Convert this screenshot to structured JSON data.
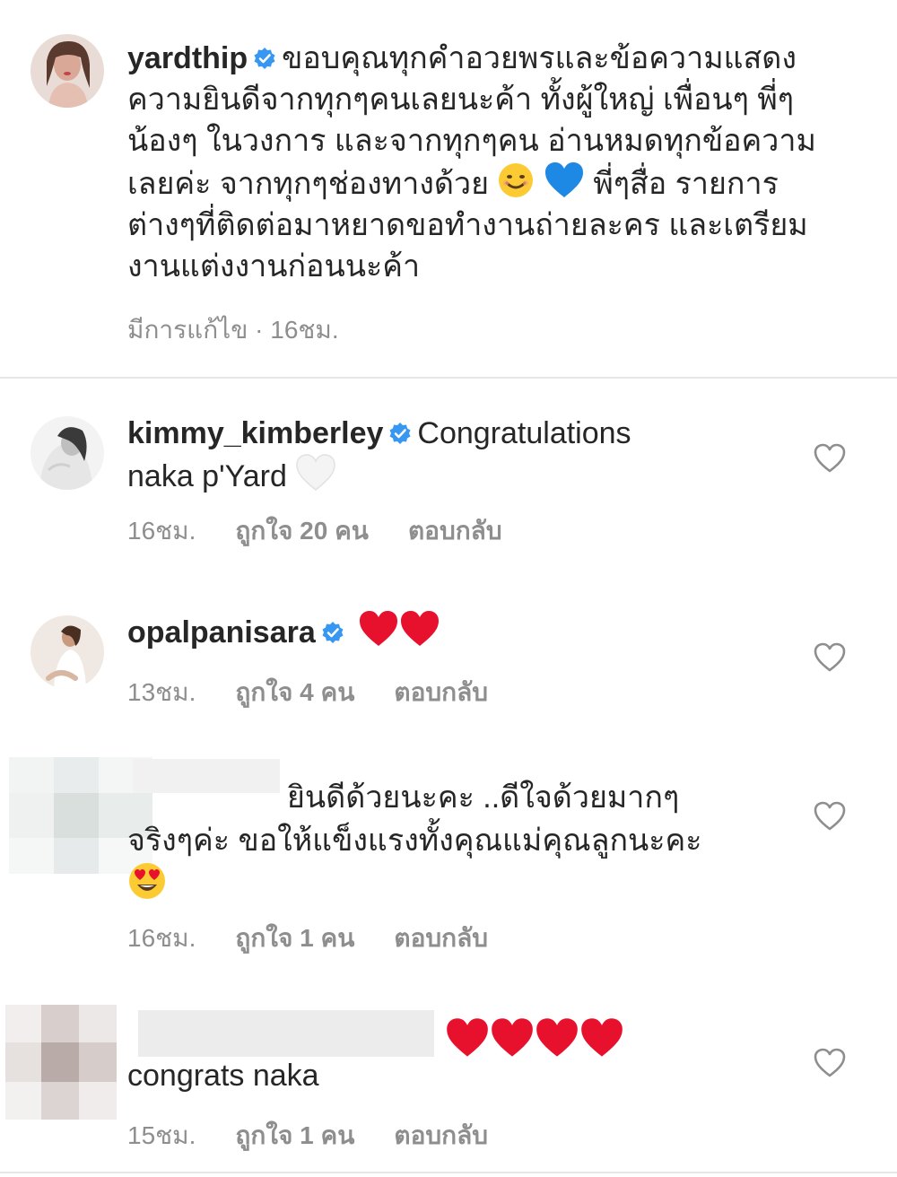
{
  "caption": {
    "username": "yardthip",
    "text_lines": [
      "ขอบคุณทุกคำอวยพรและข้อความแสดง",
      "ความยินดีจากทุกๆคนเลยนะค้า ทั้งผู้ใหญ่ เพื่อนๆ พี่ๆ",
      "น้องๆ ในวงการ และจากทุกๆคน อ่านหมดทุกข้อความ",
      "เลยค่ะ จากทุกๆช่องทางด้วย",
      "พี่ๆสื่อ รายการ",
      "ต่างๆที่ติดต่อมาหยาดขอทำงานถ่ายละคร และเตรียม",
      "งานแต่งงานก่อนนะค้า"
    ],
    "meta": "มีการแก้ไข · 16ชม."
  },
  "comments": [
    {
      "username": "kimmy_kimberley",
      "text_line1": "Congratulations",
      "text_line2": "naka p'Yard",
      "time": "16ชม.",
      "likes": "ถูกใจ 20 คน",
      "reply": "ตอบกลับ"
    },
    {
      "username": "opalpanisara",
      "time": "13ชม.",
      "likes": "ถูกใจ 4 คน",
      "reply": "ตอบกลับ"
    },
    {
      "text_line1": "ยินดีด้วยนะคะ ..ดีใจด้วยมากๆ",
      "text_line2": "จริงๆค่ะ  ขอให้แข็งแรงทั้งคุณแม่คุณลูกนะคะ",
      "time": "16ชม.",
      "likes": "ถูกใจ 1 คน",
      "reply": "ตอบกลับ"
    },
    {
      "text_line1": "congrats naka",
      "time": "15ชม.",
      "likes": "ถูกใจ 1 คน",
      "reply": "ตอบกลับ"
    }
  ],
  "colors": {
    "verified": "#3897f0",
    "meta_gray": "#8e8e8e",
    "red_heart": "#e8112d",
    "blue_heart": "#1e88e5"
  },
  "icons": [
    "verified-badge-icon",
    "heart-outline-icon",
    "red-heart-emoji",
    "blue-heart-emoji",
    "white-heart-emoji",
    "smiling-face-emoji",
    "heart-eyes-emoji"
  ]
}
